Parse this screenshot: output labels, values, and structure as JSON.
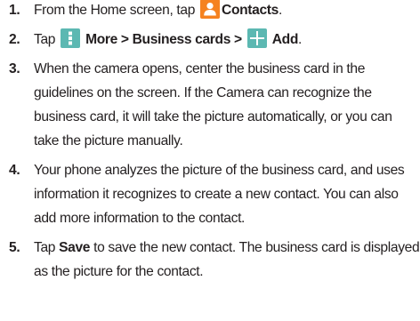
{
  "steps": [
    {
      "number": "1.",
      "text_before": "From the Home screen, tap",
      "icon": "contacts-icon",
      "bold": "Contacts",
      "text_after": "."
    },
    {
      "number": "2.",
      "text_before": "Tap",
      "icon1": "more-vertical-icon",
      "bold1": "More > Business cards >",
      "icon2": "add-plus-icon",
      "bold2": "Add",
      "text_after": "."
    },
    {
      "number": "3.",
      "text": "When the camera opens, center the business card in the guidelines on the screen. If the Camera can recognize the business card, it will take the picture automatically, or you can take the picture manually."
    },
    {
      "number": "4.",
      "text": "Your phone analyzes the picture of the business card, and uses information it recognizes to create a new contact. You can also add more information to the contact."
    },
    {
      "number": "5.",
      "text_before": "Tap",
      "bold": "Save",
      "text_after": "to save the new contact. The business card is displayed as the picture for the contact."
    }
  ],
  "colors": {
    "text": "#231f20",
    "contacts_icon_bg": "#f58220",
    "more_icon_bg": "#5cb8b2",
    "add_icon_bg": "#5cb8b2"
  }
}
